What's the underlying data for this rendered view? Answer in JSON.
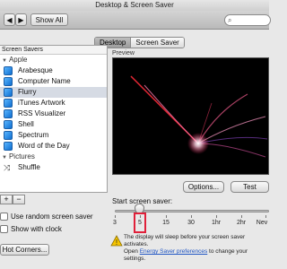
{
  "window": {
    "title": "Desktop & Screen Saver"
  },
  "toolbar": {
    "show_all": "Show All",
    "search_placeholder": ""
  },
  "tabs": [
    {
      "label": "Desktop",
      "active": true
    },
    {
      "label": "Screen Saver",
      "active": false
    }
  ],
  "screen_savers": {
    "header": "Screen Savers",
    "groups": [
      {
        "label": "Apple",
        "items": [
          "Arabesque",
          "Computer Name",
          "Flurry",
          "iTunes Artwork",
          "RSS Visualizer",
          "Shell",
          "Spectrum",
          "Word of the Day"
        ]
      },
      {
        "label": "Pictures",
        "items": []
      }
    ],
    "selected": "Flurry",
    "shuffle": "Shuffle"
  },
  "options": {
    "use_random": "Use random screen saver",
    "show_clock": "Show with clock",
    "hot_corners": "Hot Corners..."
  },
  "preview": {
    "label": "Preview"
  },
  "buttons": {
    "options": "Options...",
    "test": "Test"
  },
  "start": {
    "label": "Start screen saver:",
    "ticks": [
      "3",
      "5",
      "15",
      "30",
      "1hr",
      "2hr",
      "Nev"
    ],
    "selected_index": 1
  },
  "warning": {
    "line1": "The display will sleep before your screen saver activates.",
    "prefix": "Open ",
    "link": "Energy Saver preferences",
    "suffix": " to change your settings."
  },
  "colors": {
    "selection": "#d6dbe4",
    "highlight": "#e0203a",
    "link": "#1f55c4"
  }
}
